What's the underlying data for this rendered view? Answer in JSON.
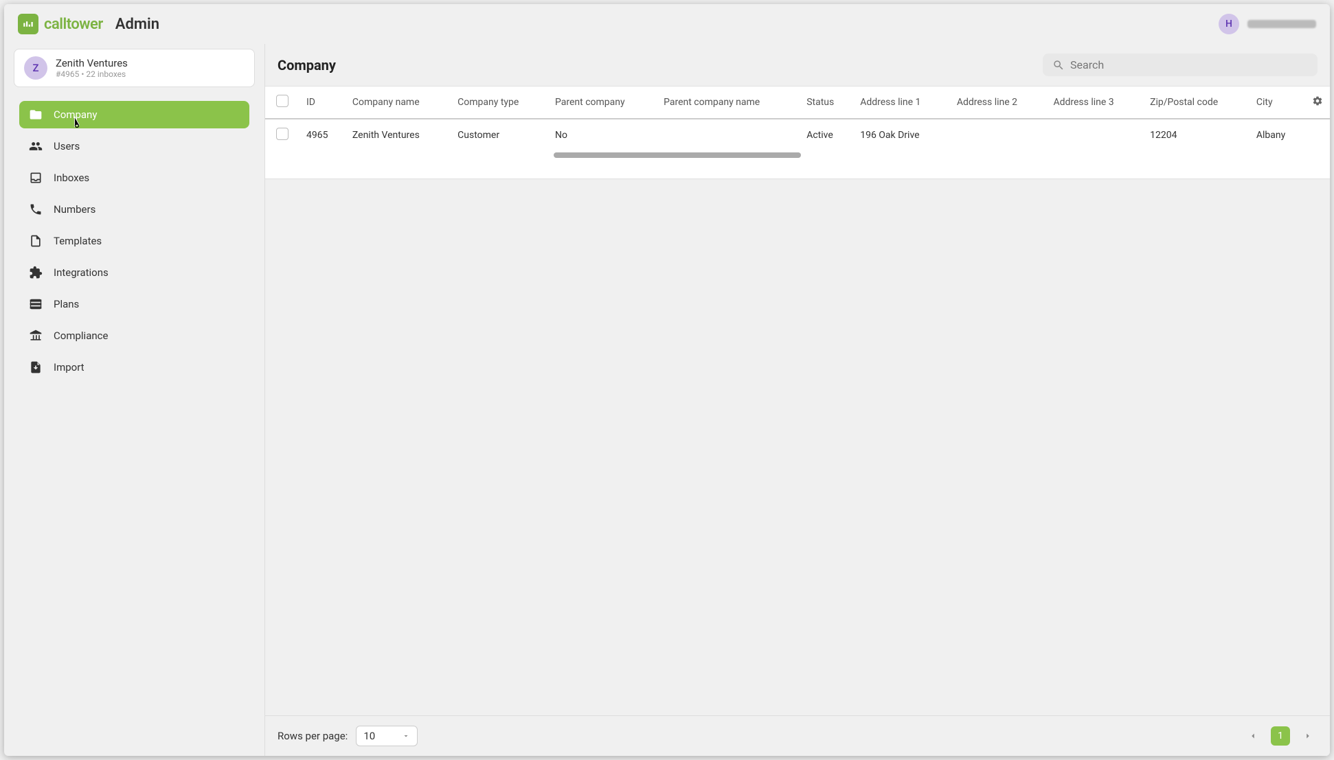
{
  "brand": {
    "name": "calltower",
    "section": "Admin"
  },
  "header": {
    "user_initial": "H"
  },
  "company_card": {
    "initial": "Z",
    "name": "Zenith Ventures",
    "meta": "#4965 • 22 inboxes"
  },
  "sidebar": {
    "items": [
      {
        "label": "Company"
      },
      {
        "label": "Users"
      },
      {
        "label": "Inboxes"
      },
      {
        "label": "Numbers"
      },
      {
        "label": "Templates"
      },
      {
        "label": "Integrations"
      },
      {
        "label": "Plans"
      },
      {
        "label": "Compliance"
      },
      {
        "label": "Import"
      }
    ]
  },
  "page": {
    "title": "Company"
  },
  "search": {
    "placeholder": "Search"
  },
  "table": {
    "headers": {
      "id": "ID",
      "company_name": "Company name",
      "company_type": "Company type",
      "parent_company": "Parent company",
      "parent_company_name": "Parent company name",
      "status": "Status",
      "address1": "Address line 1",
      "address2": "Address line 2",
      "address3": "Address line 3",
      "zip": "Zip/Postal code",
      "city": "City"
    },
    "rows": [
      {
        "id": "4965",
        "company_name": "Zenith Ventures",
        "company_type": "Customer",
        "parent_company": "No",
        "parent_company_name": "",
        "status": "Active",
        "address1": "196 Oak Drive",
        "address2": "",
        "address3": "",
        "zip": "12204",
        "city": "Albany"
      }
    ]
  },
  "pagination": {
    "rows_per_page_label": "Rows per page:",
    "rows_per_page_value": "10",
    "current_page": "1"
  }
}
